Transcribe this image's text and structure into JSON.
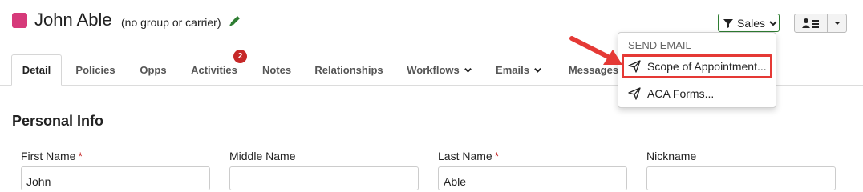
{
  "header": {
    "contact_name": "John Able",
    "group_text": "(no group or carrier)",
    "sales_label": "Sales",
    "accent_color": "#d63a7a",
    "edit_icon": "pencil-icon",
    "filter_icon": "filter-icon",
    "user_menu_icon": "user-list-icon"
  },
  "tabs": [
    {
      "label": "Detail",
      "active": true
    },
    {
      "label": "Policies"
    },
    {
      "label": "Opps"
    },
    {
      "label": "Activities",
      "badge": "2"
    },
    {
      "label": "Notes"
    },
    {
      "label": "Relationships"
    },
    {
      "label": "Workflows"
    },
    {
      "label": "Emails"
    },
    {
      "label": "Messages"
    }
  ],
  "dropdown": {
    "header": "SEND EMAIL",
    "items": [
      {
        "label": "Scope of Appointment...",
        "icon": "paper-plane-icon",
        "highlighted": true
      },
      {
        "label": "ACA Forms...",
        "icon": "paper-plane-icon"
      }
    ]
  },
  "section": {
    "title": "Personal Info",
    "fields": [
      {
        "label": "First Name",
        "required": true,
        "value": "John"
      },
      {
        "label": "Middle Name",
        "required": false,
        "value": ""
      },
      {
        "label": "Last Name",
        "required": true,
        "value": "Able"
      },
      {
        "label": "Nickname",
        "required": false,
        "value": ""
      }
    ]
  },
  "required_mark": "*",
  "colors": {
    "highlight": "#e53935",
    "badge": "#c62828",
    "sales_border": "#2e7d32"
  }
}
